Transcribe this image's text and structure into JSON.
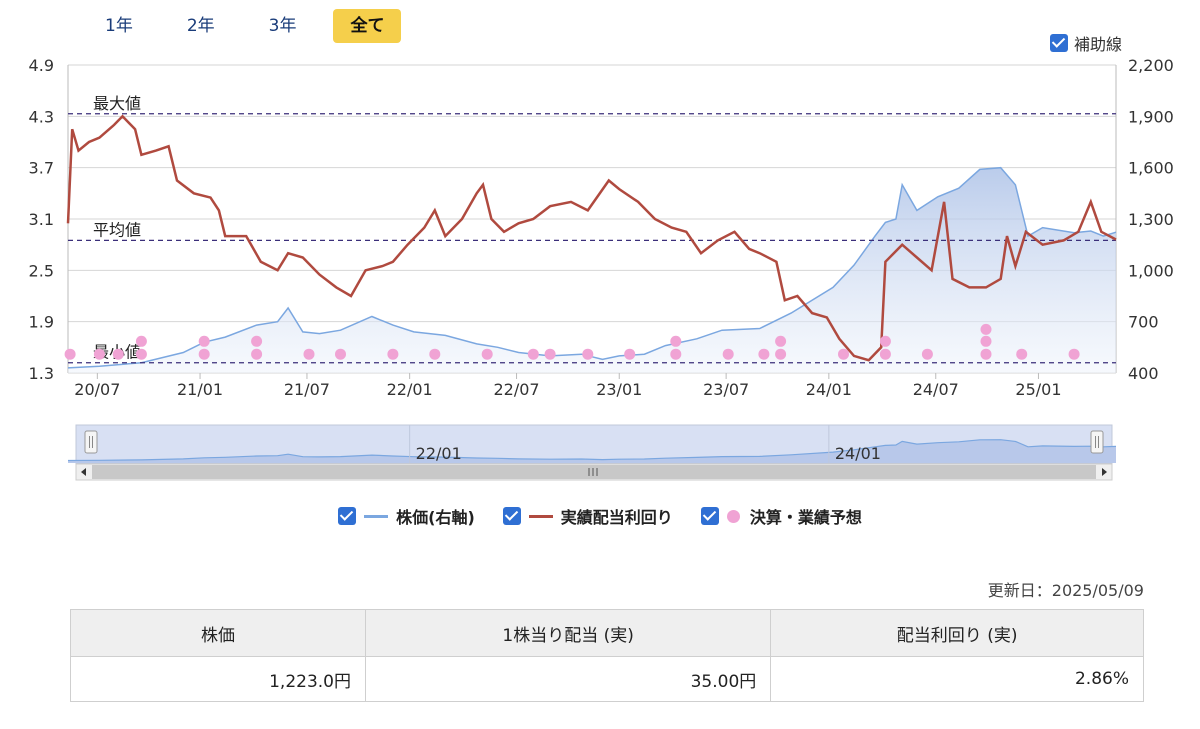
{
  "range_tabs": [
    {
      "label": "1年",
      "active": false
    },
    {
      "label": "2年",
      "active": false
    },
    {
      "label": "3年",
      "active": false
    },
    {
      "label": "全て",
      "active": true
    }
  ],
  "guide_toggle": {
    "label": "補助線",
    "checked": true
  },
  "legend": [
    {
      "label": "株価(右軸)",
      "checked": true,
      "color": "#7ba7e0",
      "marker": "line"
    },
    {
      "label": "実績配当利回り",
      "checked": true,
      "color": "#b04a3f",
      "marker": "line"
    },
    {
      "label": "決算・業績予想",
      "checked": true,
      "color": "#f0a3d4",
      "marker": "dot"
    }
  ],
  "updated": "更新日：2025/05/09",
  "summary": {
    "headers": [
      "株価",
      "1株当り配当 (実)",
      "配当利回り (実)"
    ],
    "values": [
      "1,223.0円",
      "35.00円",
      "2.86%"
    ]
  },
  "chart_data": {
    "type": "line",
    "x_ticks": [
      "20/07",
      "21/01",
      "21/07",
      "22/01",
      "22/07",
      "23/01",
      "23/07",
      "24/01",
      "24/07",
      "25/01"
    ],
    "x_tick_times": [
      2020.54,
      2021.03,
      2021.54,
      2022.03,
      2022.54,
      2023.03,
      2023.54,
      2024.03,
      2024.54,
      2025.03
    ],
    "x_range": [
      2020.4,
      2025.4
    ],
    "y_left": {
      "ticks": [
        "4.9",
        "4.3",
        "3.7",
        "3.1",
        "2.5",
        "1.9",
        "1.3"
      ],
      "range": [
        1.3,
        4.9
      ]
    },
    "y_right": {
      "ticks": [
        "2,200",
        "1,900",
        "1,600",
        "1,300",
        "1,000",
        "700",
        "400"
      ],
      "range": [
        400,
        2200
      ]
    },
    "reference_lines": [
      {
        "label": "最大値",
        "value": 4.33
      },
      {
        "label": "平均値",
        "value": 2.85
      },
      {
        "label": "最小値",
        "value": 1.42
      }
    ],
    "series": [
      {
        "name": "株価(右軸)",
        "axis": "right",
        "color": "#7ba7e0",
        "fill": true,
        "points": [
          [
            2020.4,
            430
          ],
          [
            2020.55,
            440
          ],
          [
            2020.75,
            460
          ],
          [
            2020.95,
            520
          ],
          [
            2021.05,
            580
          ],
          [
            2021.15,
            610
          ],
          [
            2021.3,
            680
          ],
          [
            2021.4,
            700
          ],
          [
            2021.45,
            780
          ],
          [
            2021.52,
            640
          ],
          [
            2021.6,
            630
          ],
          [
            2021.7,
            650
          ],
          [
            2021.85,
            730
          ],
          [
            2021.95,
            680
          ],
          [
            2022.05,
            640
          ],
          [
            2022.2,
            620
          ],
          [
            2022.35,
            570
          ],
          [
            2022.45,
            550
          ],
          [
            2022.55,
            520
          ],
          [
            2022.7,
            500
          ],
          [
            2022.85,
            510
          ],
          [
            2022.95,
            480
          ],
          [
            2023.03,
            500
          ],
          [
            2023.15,
            510
          ],
          [
            2023.25,
            560
          ],
          [
            2023.4,
            600
          ],
          [
            2023.52,
            650
          ],
          [
            2023.7,
            660
          ],
          [
            2023.85,
            750
          ],
          [
            2024.05,
            900
          ],
          [
            2024.15,
            1030
          ],
          [
            2024.25,
            1200
          ],
          [
            2024.3,
            1280
          ],
          [
            2024.35,
            1300
          ],
          [
            2024.38,
            1500
          ],
          [
            2024.45,
            1350
          ],
          [
            2024.55,
            1430
          ],
          [
            2024.65,
            1480
          ],
          [
            2024.75,
            1590
          ],
          [
            2024.85,
            1600
          ],
          [
            2024.92,
            1500
          ],
          [
            2024.98,
            1200
          ],
          [
            2025.05,
            1250
          ],
          [
            2025.2,
            1220
          ],
          [
            2025.28,
            1230
          ],
          [
            2025.34,
            1200
          ],
          [
            2025.4,
            1223
          ]
        ]
      },
      {
        "name": "実績配当利回り",
        "axis": "left",
        "color": "#b04a3f",
        "fill": false,
        "points": [
          [
            2020.4,
            3.05
          ],
          [
            2020.42,
            4.15
          ],
          [
            2020.45,
            3.9
          ],
          [
            2020.5,
            4.0
          ],
          [
            2020.55,
            4.05
          ],
          [
            2020.62,
            4.2
          ],
          [
            2020.66,
            4.3
          ],
          [
            2020.72,
            4.15
          ],
          [
            2020.75,
            3.85
          ],
          [
            2020.82,
            3.9
          ],
          [
            2020.88,
            3.95
          ],
          [
            2020.92,
            3.55
          ],
          [
            2021.0,
            3.4
          ],
          [
            2021.08,
            3.35
          ],
          [
            2021.12,
            3.2
          ],
          [
            2021.15,
            2.9
          ],
          [
            2021.25,
            2.9
          ],
          [
            2021.32,
            2.6
          ],
          [
            2021.4,
            2.5
          ],
          [
            2021.45,
            2.7
          ],
          [
            2021.52,
            2.65
          ],
          [
            2021.6,
            2.45
          ],
          [
            2021.68,
            2.3
          ],
          [
            2021.75,
            2.2
          ],
          [
            2021.82,
            2.5
          ],
          [
            2021.9,
            2.55
          ],
          [
            2021.95,
            2.6
          ],
          [
            2022.02,
            2.8
          ],
          [
            2022.1,
            3.0
          ],
          [
            2022.15,
            3.2
          ],
          [
            2022.2,
            2.9
          ],
          [
            2022.28,
            3.1
          ],
          [
            2022.35,
            3.4
          ],
          [
            2022.38,
            3.5
          ],
          [
            2022.42,
            3.1
          ],
          [
            2022.48,
            2.95
          ],
          [
            2022.55,
            3.05
          ],
          [
            2022.62,
            3.1
          ],
          [
            2022.7,
            3.25
          ],
          [
            2022.8,
            3.3
          ],
          [
            2022.88,
            3.2
          ],
          [
            2022.98,
            3.55
          ],
          [
            2023.03,
            3.45
          ],
          [
            2023.12,
            3.3
          ],
          [
            2023.2,
            3.1
          ],
          [
            2023.28,
            3.0
          ],
          [
            2023.35,
            2.95
          ],
          [
            2023.42,
            2.7
          ],
          [
            2023.5,
            2.85
          ],
          [
            2023.58,
            2.95
          ],
          [
            2023.65,
            2.75
          ],
          [
            2023.7,
            2.7
          ],
          [
            2023.78,
            2.6
          ],
          [
            2023.82,
            2.15
          ],
          [
            2023.88,
            2.2
          ],
          [
            2023.95,
            2.0
          ],
          [
            2024.02,
            1.95
          ],
          [
            2024.08,
            1.7
          ],
          [
            2024.15,
            1.5
          ],
          [
            2024.22,
            1.45
          ],
          [
            2024.28,
            1.6
          ],
          [
            2024.3,
            2.6
          ],
          [
            2024.38,
            2.8
          ],
          [
            2024.45,
            2.65
          ],
          [
            2024.52,
            2.5
          ],
          [
            2024.58,
            3.3
          ],
          [
            2024.62,
            2.4
          ],
          [
            2024.7,
            2.3
          ],
          [
            2024.78,
            2.3
          ],
          [
            2024.85,
            2.4
          ],
          [
            2024.88,
            2.9
          ],
          [
            2024.92,
            2.55
          ],
          [
            2024.97,
            2.95
          ],
          [
            2025.05,
            2.8
          ],
          [
            2025.15,
            2.85
          ],
          [
            2025.22,
            2.95
          ],
          [
            2025.28,
            3.3
          ],
          [
            2025.33,
            2.95
          ],
          [
            2025.4,
            2.86
          ]
        ]
      }
    ],
    "events_left_axis": [
      [
        2020.41,
        1.52
      ],
      [
        2020.55,
        1.52
      ],
      [
        2020.64,
        1.52
      ],
      [
        2020.75,
        1.52
      ],
      [
        2021.05,
        1.52
      ],
      [
        2021.3,
        1.52
      ],
      [
        2021.55,
        1.52
      ],
      [
        2021.7,
        1.52
      ],
      [
        2021.95,
        1.52
      ],
      [
        2022.15,
        1.52
      ],
      [
        2022.4,
        1.52
      ],
      [
        2022.62,
        1.52
      ],
      [
        2022.7,
        1.52
      ],
      [
        2022.88,
        1.52
      ],
      [
        2023.08,
        1.52
      ],
      [
        2023.3,
        1.52
      ],
      [
        2023.55,
        1.52
      ],
      [
        2023.72,
        1.52
      ],
      [
        2023.8,
        1.52
      ],
      [
        2024.1,
        1.52
      ],
      [
        2024.3,
        1.52
      ],
      [
        2024.5,
        1.52
      ],
      [
        2024.78,
        1.52
      ],
      [
        2024.95,
        1.52
      ],
      [
        2025.2,
        1.52
      ],
      [
        2021.05,
        1.67
      ],
      [
        2021.3,
        1.67
      ],
      [
        2023.3,
        1.67
      ],
      [
        2023.8,
        1.67
      ],
      [
        2024.3,
        1.67
      ],
      [
        2024.78,
        1.67
      ],
      [
        2024.78,
        1.81
      ],
      [
        2020.75,
        1.67
      ]
    ],
    "navigator": {
      "labels": [
        "22/01",
        "24/01"
      ]
    }
  }
}
